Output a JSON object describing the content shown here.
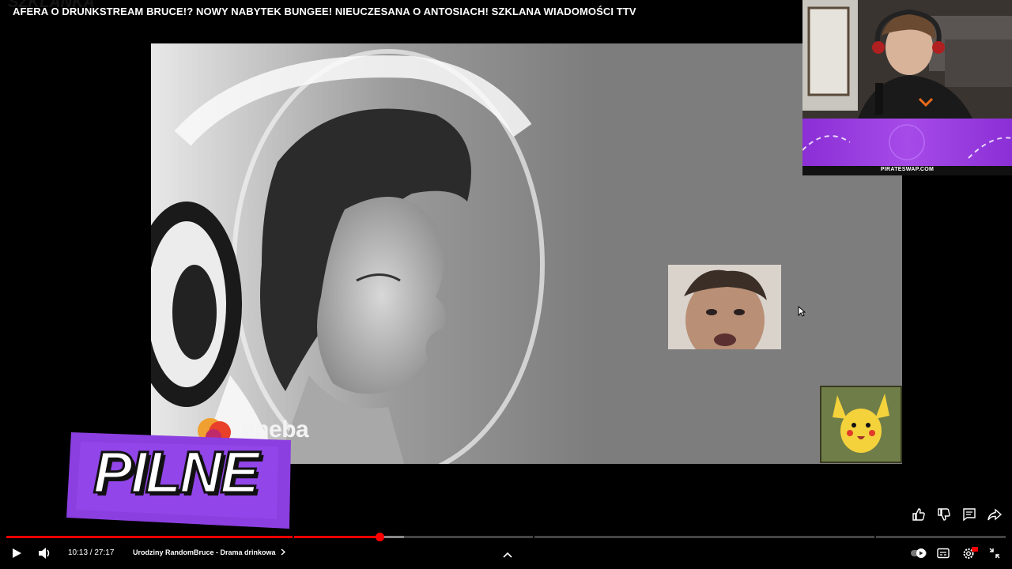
{
  "video": {
    "title": "AFERA O DRUNKSTREAM BRUCE!? NOWY NABYTEK BUNGEE! NIEUCZESANA O ANTOSIACH! SZKLANA WIADOMOŚCI TTV",
    "overlay_brand": "eneba",
    "streamer_banner_text": "PIRATESWAP.COM",
    "badge_text": "PILNE"
  },
  "player": {
    "current_time": "10:13",
    "duration": "27:17",
    "time_display": "10:13 / 27:17",
    "chapter_title": "Urodziny RandomBruce - Drama drinkowa",
    "progress": 0.374,
    "buffered": 0.398
  },
  "colors": {
    "accent": "#ff0000",
    "badge_purple": "#8b3fe0",
    "banner_purple": "#9b3fe0"
  },
  "icons": [
    "play-icon",
    "volume-icon",
    "chevron-right-icon",
    "chevron-up-icon",
    "autoplay-toggle-icon",
    "subtitles-icon",
    "settings-icon",
    "exit-fullscreen-icon",
    "like-icon",
    "dislike-icon",
    "comment-icon",
    "share-icon"
  ]
}
